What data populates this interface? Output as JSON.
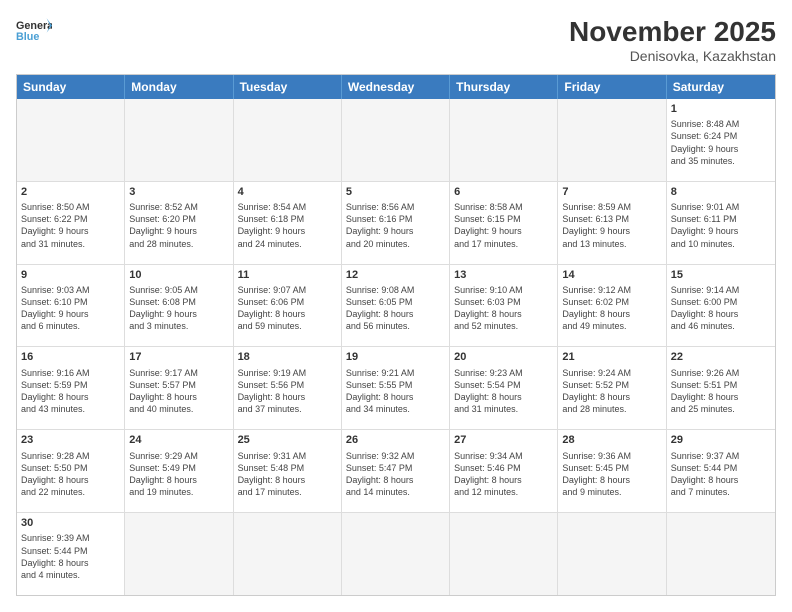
{
  "header": {
    "logo_general": "General",
    "logo_blue": "Blue",
    "month_year": "November 2025",
    "location": "Denisovka, Kazakhstan"
  },
  "weekdays": [
    "Sunday",
    "Monday",
    "Tuesday",
    "Wednesday",
    "Thursday",
    "Friday",
    "Saturday"
  ],
  "rows": [
    [
      {
        "day": "",
        "info": "",
        "empty": true
      },
      {
        "day": "",
        "info": "",
        "empty": true
      },
      {
        "day": "",
        "info": "",
        "empty": true
      },
      {
        "day": "",
        "info": "",
        "empty": true
      },
      {
        "day": "",
        "info": "",
        "empty": true
      },
      {
        "day": "",
        "info": "",
        "empty": true
      },
      {
        "day": "1",
        "info": "Sunrise: 8:48 AM\nSunset: 6:24 PM\nDaylight: 9 hours\nand 35 minutes.",
        "empty": false
      }
    ],
    [
      {
        "day": "2",
        "info": "Sunrise: 8:50 AM\nSunset: 6:22 PM\nDaylight: 9 hours\nand 31 minutes.",
        "empty": false
      },
      {
        "day": "3",
        "info": "Sunrise: 8:52 AM\nSunset: 6:20 PM\nDaylight: 9 hours\nand 28 minutes.",
        "empty": false
      },
      {
        "day": "4",
        "info": "Sunrise: 8:54 AM\nSunset: 6:18 PM\nDaylight: 9 hours\nand 24 minutes.",
        "empty": false
      },
      {
        "day": "5",
        "info": "Sunrise: 8:56 AM\nSunset: 6:16 PM\nDaylight: 9 hours\nand 20 minutes.",
        "empty": false
      },
      {
        "day": "6",
        "info": "Sunrise: 8:58 AM\nSunset: 6:15 PM\nDaylight: 9 hours\nand 17 minutes.",
        "empty": false
      },
      {
        "day": "7",
        "info": "Sunrise: 8:59 AM\nSunset: 6:13 PM\nDaylight: 9 hours\nand 13 minutes.",
        "empty": false
      },
      {
        "day": "8",
        "info": "Sunrise: 9:01 AM\nSunset: 6:11 PM\nDaylight: 9 hours\nand 10 minutes.",
        "empty": false
      }
    ],
    [
      {
        "day": "9",
        "info": "Sunrise: 9:03 AM\nSunset: 6:10 PM\nDaylight: 9 hours\nand 6 minutes.",
        "empty": false
      },
      {
        "day": "10",
        "info": "Sunrise: 9:05 AM\nSunset: 6:08 PM\nDaylight: 9 hours\nand 3 minutes.",
        "empty": false
      },
      {
        "day": "11",
        "info": "Sunrise: 9:07 AM\nSunset: 6:06 PM\nDaylight: 8 hours\nand 59 minutes.",
        "empty": false
      },
      {
        "day": "12",
        "info": "Sunrise: 9:08 AM\nSunset: 6:05 PM\nDaylight: 8 hours\nand 56 minutes.",
        "empty": false
      },
      {
        "day": "13",
        "info": "Sunrise: 9:10 AM\nSunset: 6:03 PM\nDaylight: 8 hours\nand 52 minutes.",
        "empty": false
      },
      {
        "day": "14",
        "info": "Sunrise: 9:12 AM\nSunset: 6:02 PM\nDaylight: 8 hours\nand 49 minutes.",
        "empty": false
      },
      {
        "day": "15",
        "info": "Sunrise: 9:14 AM\nSunset: 6:00 PM\nDaylight: 8 hours\nand 46 minutes.",
        "empty": false
      }
    ],
    [
      {
        "day": "16",
        "info": "Sunrise: 9:16 AM\nSunset: 5:59 PM\nDaylight: 8 hours\nand 43 minutes.",
        "empty": false
      },
      {
        "day": "17",
        "info": "Sunrise: 9:17 AM\nSunset: 5:57 PM\nDaylight: 8 hours\nand 40 minutes.",
        "empty": false
      },
      {
        "day": "18",
        "info": "Sunrise: 9:19 AM\nSunset: 5:56 PM\nDaylight: 8 hours\nand 37 minutes.",
        "empty": false
      },
      {
        "day": "19",
        "info": "Sunrise: 9:21 AM\nSunset: 5:55 PM\nDaylight: 8 hours\nand 34 minutes.",
        "empty": false
      },
      {
        "day": "20",
        "info": "Sunrise: 9:23 AM\nSunset: 5:54 PM\nDaylight: 8 hours\nand 31 minutes.",
        "empty": false
      },
      {
        "day": "21",
        "info": "Sunrise: 9:24 AM\nSunset: 5:52 PM\nDaylight: 8 hours\nand 28 minutes.",
        "empty": false
      },
      {
        "day": "22",
        "info": "Sunrise: 9:26 AM\nSunset: 5:51 PM\nDaylight: 8 hours\nand 25 minutes.",
        "empty": false
      }
    ],
    [
      {
        "day": "23",
        "info": "Sunrise: 9:28 AM\nSunset: 5:50 PM\nDaylight: 8 hours\nand 22 minutes.",
        "empty": false
      },
      {
        "day": "24",
        "info": "Sunrise: 9:29 AM\nSunset: 5:49 PM\nDaylight: 8 hours\nand 19 minutes.",
        "empty": false
      },
      {
        "day": "25",
        "info": "Sunrise: 9:31 AM\nSunset: 5:48 PM\nDaylight: 8 hours\nand 17 minutes.",
        "empty": false
      },
      {
        "day": "26",
        "info": "Sunrise: 9:32 AM\nSunset: 5:47 PM\nDaylight: 8 hours\nand 14 minutes.",
        "empty": false
      },
      {
        "day": "27",
        "info": "Sunrise: 9:34 AM\nSunset: 5:46 PM\nDaylight: 8 hours\nand 12 minutes.",
        "empty": false
      },
      {
        "day": "28",
        "info": "Sunrise: 9:36 AM\nSunset: 5:45 PM\nDaylight: 8 hours\nand 9 minutes.",
        "empty": false
      },
      {
        "day": "29",
        "info": "Sunrise: 9:37 AM\nSunset: 5:44 PM\nDaylight: 8 hours\nand 7 minutes.",
        "empty": false
      }
    ],
    [
      {
        "day": "30",
        "info": "Sunrise: 9:39 AM\nSunset: 5:44 PM\nDaylight: 8 hours\nand 4 minutes.",
        "empty": false
      },
      {
        "day": "",
        "info": "",
        "empty": true
      },
      {
        "day": "",
        "info": "",
        "empty": true
      },
      {
        "day": "",
        "info": "",
        "empty": true
      },
      {
        "day": "",
        "info": "",
        "empty": true
      },
      {
        "day": "",
        "info": "",
        "empty": true
      },
      {
        "day": "",
        "info": "",
        "empty": true
      }
    ]
  ]
}
